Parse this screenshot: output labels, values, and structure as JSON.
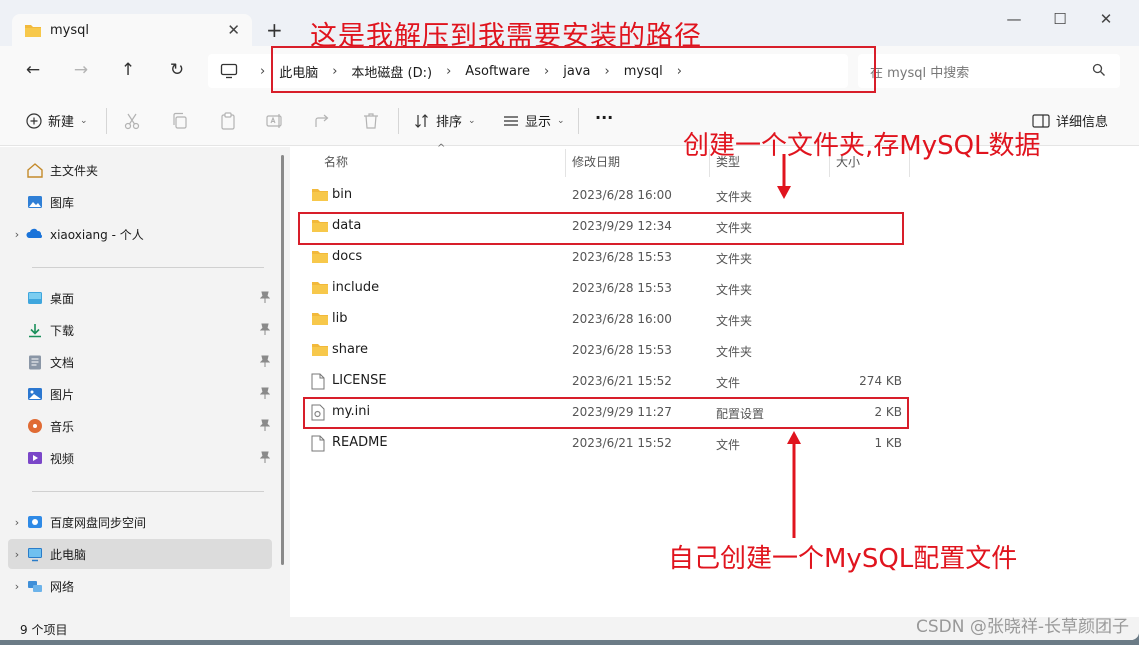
{
  "window": {
    "tab_title": "mysql",
    "close_glyph": "✕",
    "new_tab_glyph": "+",
    "minimize_glyph": "—",
    "maximize_glyph": "☐",
    "close_window_glyph": "✕"
  },
  "annotations": {
    "install_path": "这是我解压到我需要安装的路径",
    "data_folder": "创建一个文件夹,存MySQL数据",
    "config_file": "自己创建一个MySQL配置文件"
  },
  "nav": {
    "back": "←",
    "forward": "→",
    "up": "↑",
    "refresh": "↻",
    "breadcrumbs": [
      "此电脑",
      "本地磁盘 (D:)",
      "Asoftware",
      "java",
      "mysql"
    ],
    "search_placeholder": "在 mysql 中搜索"
  },
  "toolbar": {
    "new_label": "新建",
    "sort_label": "排序",
    "view_label": "显示",
    "more_label": "···",
    "details_label": "详细信息"
  },
  "sidebar": {
    "items": [
      {
        "label": "主文件夹",
        "icon": "home-icon",
        "chev": ""
      },
      {
        "label": "图库",
        "icon": "gallery-icon",
        "chev": ""
      },
      {
        "label": "xiaoxiang - 个人",
        "icon": "onedrive-icon",
        "chev": "›"
      },
      {
        "label": "桌面",
        "icon": "desktop-icon",
        "chev": "",
        "pin": true
      },
      {
        "label": "下载",
        "icon": "download-icon",
        "chev": "",
        "pin": true
      },
      {
        "label": "文档",
        "icon": "documents-icon",
        "chev": "",
        "pin": true
      },
      {
        "label": "图片",
        "icon": "pictures-icon",
        "chev": "",
        "pin": true
      },
      {
        "label": "音乐",
        "icon": "music-icon",
        "chev": "",
        "pin": true
      },
      {
        "label": "视频",
        "icon": "videos-icon",
        "chev": "",
        "pin": true
      },
      {
        "label": "百度网盘同步空间",
        "icon": "baidu-icon",
        "chev": "›"
      },
      {
        "label": "此电脑",
        "icon": "this-pc-icon",
        "chev": "›"
      },
      {
        "label": "网络",
        "icon": "network-icon",
        "chev": "›"
      }
    ],
    "pin_glyph": "📌"
  },
  "columns": {
    "name": "名称",
    "modified": "修改日期",
    "type": "类型",
    "size": "大小"
  },
  "files": [
    {
      "name": "bin",
      "date": "2023/6/28 16:00",
      "type": "文件夹",
      "size": "",
      "kind": "folder"
    },
    {
      "name": "data",
      "date": "2023/9/29 12:34",
      "type": "文件夹",
      "size": "",
      "kind": "folder"
    },
    {
      "name": "docs",
      "date": "2023/6/28 15:53",
      "type": "文件夹",
      "size": "",
      "kind": "folder"
    },
    {
      "name": "include",
      "date": "2023/6/28 15:53",
      "type": "文件夹",
      "size": "",
      "kind": "folder"
    },
    {
      "name": "lib",
      "date": "2023/6/28 16:00",
      "type": "文件夹",
      "size": "",
      "kind": "folder"
    },
    {
      "name": "share",
      "date": "2023/6/28 15:53",
      "type": "文件夹",
      "size": "",
      "kind": "folder"
    },
    {
      "name": "LICENSE",
      "date": "2023/6/21 15:52",
      "type": "文件",
      "size": "274 KB",
      "kind": "file"
    },
    {
      "name": "my.ini",
      "date": "2023/9/29 11:27",
      "type": "配置设置",
      "size": "2 KB",
      "kind": "ini"
    },
    {
      "name": "README",
      "date": "2023/6/21 15:52",
      "type": "文件",
      "size": "1 KB",
      "kind": "file"
    }
  ],
  "status": {
    "item_count": "9 个项目"
  },
  "watermark": "CSDN @张晓祥-长草颜团子",
  "colors": {
    "annotation_red": "#e0141e",
    "folder_yellow": "#f7c84b"
  }
}
